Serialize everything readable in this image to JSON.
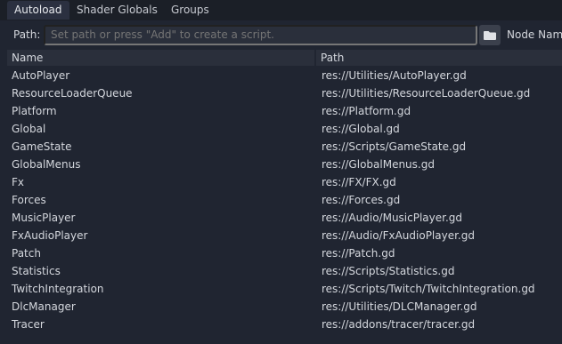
{
  "tabs": [
    {
      "label": "Autoload",
      "active": true
    },
    {
      "label": "Shader Globals",
      "active": false
    },
    {
      "label": "Groups",
      "active": false
    }
  ],
  "path_bar": {
    "label": "Path:",
    "placeholder": "Set path or press \"Add\" to create a script.",
    "folder_icon": "folder-icon",
    "node_name_label": "Node Name"
  },
  "table": {
    "headers": {
      "name": "Name",
      "path": "Path"
    },
    "rows": [
      {
        "name": "AutoPlayer",
        "path": "res://Utilities/AutoPlayer.gd"
      },
      {
        "name": "ResourceLoaderQueue",
        "path": "res://Utilities/ResourceLoaderQueue.gd"
      },
      {
        "name": "Platform",
        "path": "res://Platform.gd"
      },
      {
        "name": "Global",
        "path": "res://Global.gd"
      },
      {
        "name": "GameState",
        "path": "res://Scripts/GameState.gd"
      },
      {
        "name": "GlobalMenus",
        "path": "res://GlobalMenus.gd"
      },
      {
        "name": "Fx",
        "path": "res://FX/FX.gd"
      },
      {
        "name": "Forces",
        "path": "res://Forces.gd"
      },
      {
        "name": "MusicPlayer",
        "path": "res://Audio/MusicPlayer.gd"
      },
      {
        "name": "FxAudioPlayer",
        "path": "res://Audio/FxAudioPlayer.gd"
      },
      {
        "name": "Patch",
        "path": "res://Patch.gd"
      },
      {
        "name": "Statistics",
        "path": "res://Scripts/Statistics.gd"
      },
      {
        "name": "TwitchIntegration",
        "path": "res://Scripts/Twitch/TwitchIntegration.gd"
      },
      {
        "name": "DlcManager",
        "path": "res://Utilities/DLCManager.gd"
      },
      {
        "name": "Tracer",
        "path": "res://addons/tracer/tracer.gd"
      }
    ]
  },
  "colors": {
    "background": "#202531",
    "tabbar": "#1b1f27",
    "active_tab": "#2b3040",
    "input": "#2a2f3b",
    "text": "#d4d7dd",
    "placeholder": "#777c87"
  }
}
